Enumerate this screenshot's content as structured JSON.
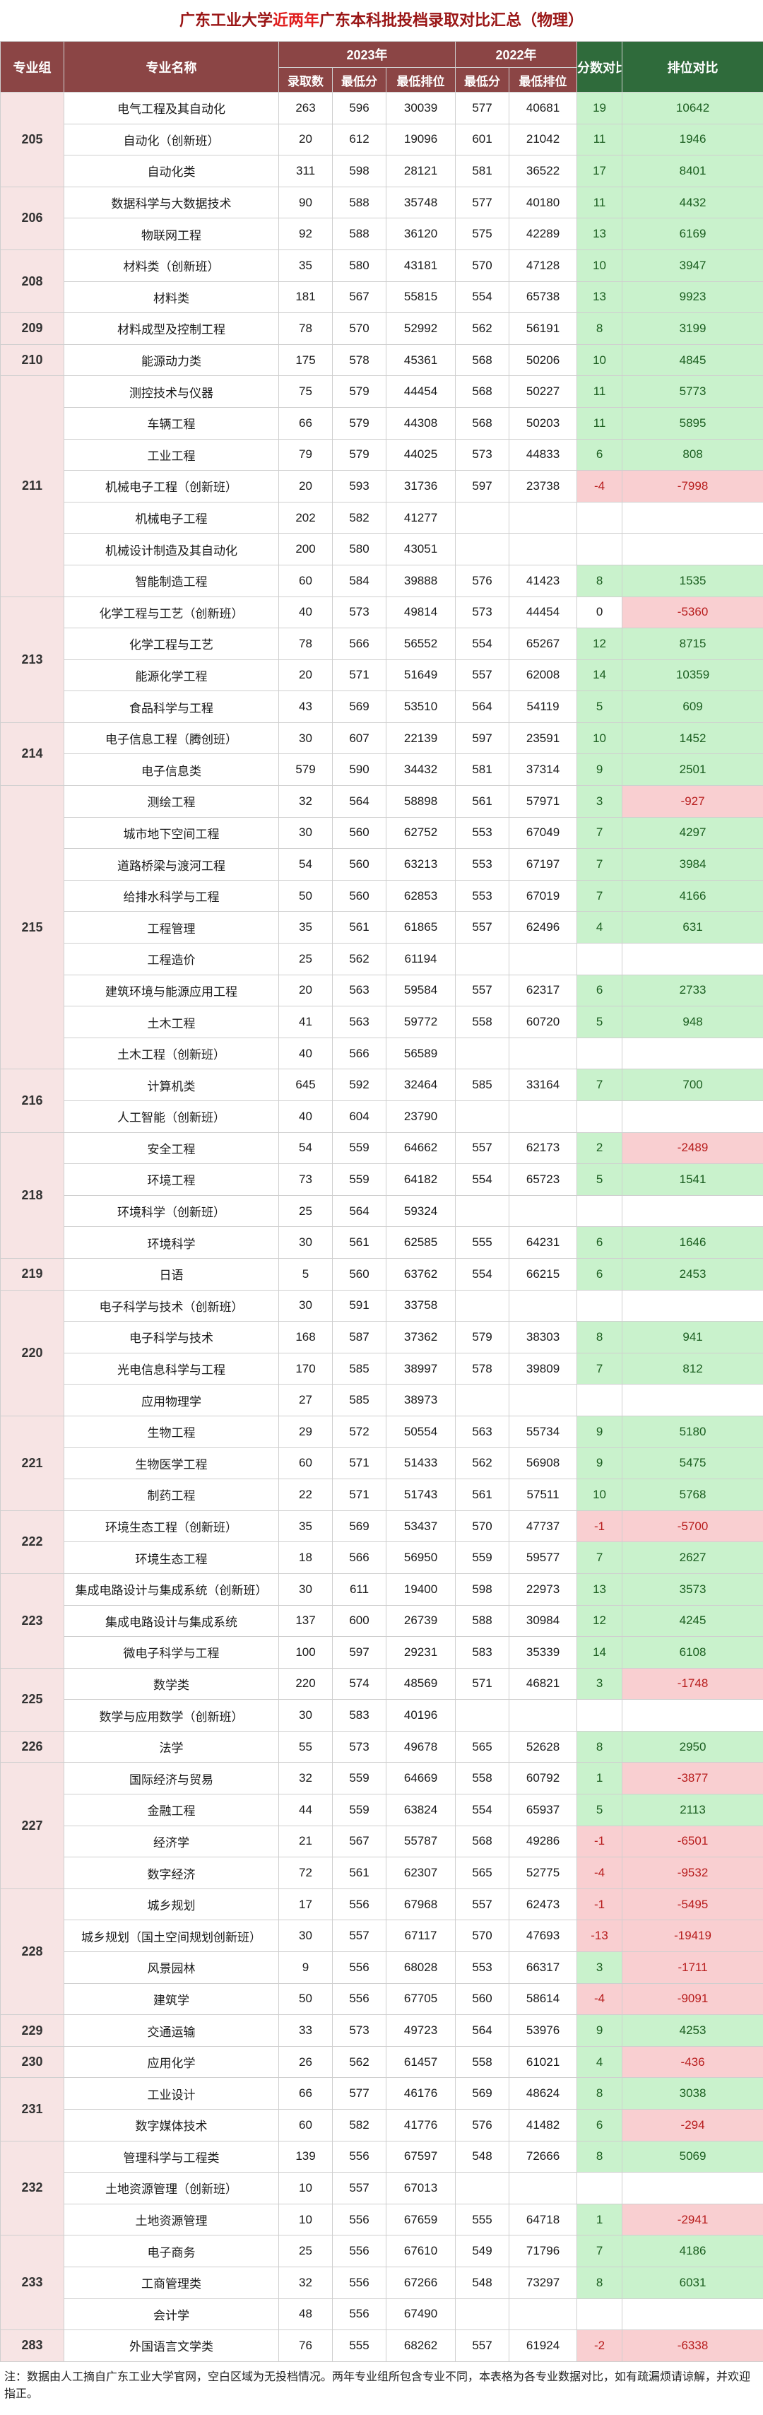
{
  "title": {
    "part1": "广东工业大学",
    "part2": "近两年",
    "part3": "广东本科批投档录取对比汇总（物理）"
  },
  "header": {
    "group": "专业组",
    "major": "专业名称",
    "y2023": "2023年",
    "y2022": "2022年",
    "enroll": "录取数",
    "minScore": "最低分",
    "minRank": "最低排位",
    "diffScore": "分数对比",
    "diffRank": "排位对比"
  },
  "groups": [
    {
      "group": "205",
      "rows": [
        [
          "电气工程及其自动化",
          "263",
          "596",
          "30039",
          "577",
          "40681",
          "19",
          "10642"
        ],
        [
          "自动化（创新班）",
          "20",
          "612",
          "19096",
          "601",
          "21042",
          "11",
          "1946"
        ],
        [
          "自动化类",
          "311",
          "598",
          "28121",
          "581",
          "36522",
          "17",
          "8401"
        ]
      ]
    },
    {
      "group": "206",
      "rows": [
        [
          "数据科学与大数据技术",
          "90",
          "588",
          "35748",
          "577",
          "40180",
          "11",
          "4432"
        ],
        [
          "物联网工程",
          "92",
          "588",
          "36120",
          "575",
          "42289",
          "13",
          "6169"
        ]
      ]
    },
    {
      "group": "208",
      "rows": [
        [
          "材料类（创新班）",
          "35",
          "580",
          "43181",
          "570",
          "47128",
          "10",
          "3947"
        ],
        [
          "材料类",
          "181",
          "567",
          "55815",
          "554",
          "65738",
          "13",
          "9923"
        ]
      ]
    },
    {
      "group": "209",
      "rows": [
        [
          "材料成型及控制工程",
          "78",
          "570",
          "52992",
          "562",
          "56191",
          "8",
          "3199"
        ]
      ]
    },
    {
      "group": "210",
      "rows": [
        [
          "能源动力类",
          "175",
          "578",
          "45361",
          "568",
          "50206",
          "10",
          "4845"
        ]
      ]
    },
    {
      "group": "211",
      "rows": [
        [
          "测控技术与仪器",
          "75",
          "579",
          "44454",
          "568",
          "50227",
          "11",
          "5773"
        ],
        [
          "车辆工程",
          "66",
          "579",
          "44308",
          "568",
          "50203",
          "11",
          "5895"
        ],
        [
          "工业工程",
          "79",
          "579",
          "44025",
          "573",
          "44833",
          "6",
          "808"
        ],
        [
          "机械电子工程（创新班）",
          "20",
          "593",
          "31736",
          "597",
          "23738",
          "-4",
          "-7998"
        ],
        [
          "机械电子工程",
          "202",
          "582",
          "41277",
          "",
          "",
          "",
          ""
        ],
        [
          "机械设计制造及其自动化",
          "200",
          "580",
          "43051",
          "",
          "",
          "",
          ""
        ],
        [
          "智能制造工程",
          "60",
          "584",
          "39888",
          "576",
          "41423",
          "8",
          "1535"
        ]
      ]
    },
    {
      "group": "213",
      "rows": [
        [
          "化学工程与工艺（创新班）",
          "40",
          "573",
          "49814",
          "573",
          "44454",
          "0",
          "-5360"
        ],
        [
          "化学工程与工艺",
          "78",
          "566",
          "56552",
          "554",
          "65267",
          "12",
          "8715"
        ],
        [
          "能源化学工程",
          "20",
          "571",
          "51649",
          "557",
          "62008",
          "14",
          "10359"
        ],
        [
          "食品科学与工程",
          "43",
          "569",
          "53510",
          "564",
          "54119",
          "5",
          "609"
        ]
      ]
    },
    {
      "group": "214",
      "rows": [
        [
          "电子信息工程（腾创班）",
          "30",
          "607",
          "22139",
          "597",
          "23591",
          "10",
          "1452"
        ],
        [
          "电子信息类",
          "579",
          "590",
          "34432",
          "581",
          "37314",
          "9",
          "2501"
        ]
      ]
    },
    {
      "group": "215",
      "rows": [
        [
          "测绘工程",
          "32",
          "564",
          "58898",
          "561",
          "57971",
          "3",
          "-927"
        ],
        [
          "城市地下空间工程",
          "30",
          "560",
          "62752",
          "553",
          "67049",
          "7",
          "4297"
        ],
        [
          "道路桥梁与渡河工程",
          "54",
          "560",
          "63213",
          "553",
          "67197",
          "7",
          "3984"
        ],
        [
          "给排水科学与工程",
          "50",
          "560",
          "62853",
          "553",
          "67019",
          "7",
          "4166"
        ],
        [
          "工程管理",
          "35",
          "561",
          "61865",
          "557",
          "62496",
          "4",
          "631"
        ],
        [
          "工程造价",
          "25",
          "562",
          "61194",
          "",
          "",
          "",
          ""
        ],
        [
          "建筑环境与能源应用工程",
          "20",
          "563",
          "59584",
          "557",
          "62317",
          "6",
          "2733"
        ],
        [
          "土木工程",
          "41",
          "563",
          "59772",
          "558",
          "60720",
          "5",
          "948"
        ],
        [
          "土木工程（创新班）",
          "40",
          "566",
          "56589",
          "",
          "",
          "",
          ""
        ]
      ]
    },
    {
      "group": "216",
      "rows": [
        [
          "计算机类",
          "645",
          "592",
          "32464",
          "585",
          "33164",
          "7",
          "700"
        ],
        [
          "人工智能（创新班）",
          "40",
          "604",
          "23790",
          "",
          "",
          "",
          ""
        ]
      ]
    },
    {
      "group": "218",
      "rows": [
        [
          "安全工程",
          "54",
          "559",
          "64662",
          "557",
          "62173",
          "2",
          "-2489"
        ],
        [
          "环境工程",
          "73",
          "559",
          "64182",
          "554",
          "65723",
          "5",
          "1541"
        ],
        [
          "环境科学（创新班）",
          "25",
          "564",
          "59324",
          "",
          "",
          "",
          ""
        ],
        [
          "环境科学",
          "30",
          "561",
          "62585",
          "555",
          "64231",
          "6",
          "1646"
        ]
      ]
    },
    {
      "group": "219",
      "rows": [
        [
          "日语",
          "5",
          "560",
          "63762",
          "554",
          "66215",
          "6",
          "2453"
        ]
      ]
    },
    {
      "group": "220",
      "rows": [
        [
          "电子科学与技术（创新班）",
          "30",
          "591",
          "33758",
          "",
          "",
          "",
          ""
        ],
        [
          "电子科学与技术",
          "168",
          "587",
          "37362",
          "579",
          "38303",
          "8",
          "941"
        ],
        [
          "光电信息科学与工程",
          "170",
          "585",
          "38997",
          "578",
          "39809",
          "7",
          "812"
        ],
        [
          "应用物理学",
          "27",
          "585",
          "38973",
          "",
          "",
          "",
          ""
        ]
      ]
    },
    {
      "group": "221",
      "rows": [
        [
          "生物工程",
          "29",
          "572",
          "50554",
          "563",
          "55734",
          "9",
          "5180"
        ],
        [
          "生物医学工程",
          "60",
          "571",
          "51433",
          "562",
          "56908",
          "9",
          "5475"
        ],
        [
          "制药工程",
          "22",
          "571",
          "51743",
          "561",
          "57511",
          "10",
          "5768"
        ]
      ]
    },
    {
      "group": "222",
      "rows": [
        [
          "环境生态工程（创新班）",
          "35",
          "569",
          "53437",
          "570",
          "47737",
          "-1",
          "-5700"
        ],
        [
          "环境生态工程",
          "18",
          "566",
          "56950",
          "559",
          "59577",
          "7",
          "2627"
        ]
      ]
    },
    {
      "group": "223",
      "rows": [
        [
          "集成电路设计与集成系统（创新班）",
          "30",
          "611",
          "19400",
          "598",
          "22973",
          "13",
          "3573"
        ],
        [
          "集成电路设计与集成系统",
          "137",
          "600",
          "26739",
          "588",
          "30984",
          "12",
          "4245"
        ],
        [
          "微电子科学与工程",
          "100",
          "597",
          "29231",
          "583",
          "35339",
          "14",
          "6108"
        ]
      ]
    },
    {
      "group": "225",
      "rows": [
        [
          "数学类",
          "220",
          "574",
          "48569",
          "571",
          "46821",
          "3",
          "-1748"
        ],
        [
          "数学与应用数学（创新班）",
          "30",
          "583",
          "40196",
          "",
          "",
          "",
          ""
        ]
      ]
    },
    {
      "group": "226",
      "rows": [
        [
          "法学",
          "55",
          "573",
          "49678",
          "565",
          "52628",
          "8",
          "2950"
        ]
      ]
    },
    {
      "group": "227",
      "rows": [
        [
          "国际经济与贸易",
          "32",
          "559",
          "64669",
          "558",
          "60792",
          "1",
          "-3877"
        ],
        [
          "金融工程",
          "44",
          "559",
          "63824",
          "554",
          "65937",
          "5",
          "2113"
        ],
        [
          "经济学",
          "21",
          "567",
          "55787",
          "568",
          "49286",
          "-1",
          "-6501"
        ],
        [
          "数字经济",
          "72",
          "561",
          "62307",
          "565",
          "52775",
          "-4",
          "-9532"
        ]
      ]
    },
    {
      "group": "228",
      "rows": [
        [
          "城乡规划",
          "17",
          "556",
          "67968",
          "557",
          "62473",
          "-1",
          "-5495"
        ],
        [
          "城乡规划（国土空间规划创新班）",
          "30",
          "557",
          "67117",
          "570",
          "47693",
          "-13",
          "-19419"
        ],
        [
          "风景园林",
          "9",
          "556",
          "68028",
          "553",
          "66317",
          "3",
          "-1711"
        ],
        [
          "建筑学",
          "50",
          "556",
          "67705",
          "560",
          "58614",
          "-4",
          "-9091"
        ]
      ]
    },
    {
      "group": "229",
      "rows": [
        [
          "交通运输",
          "33",
          "573",
          "49723",
          "564",
          "53976",
          "9",
          "4253"
        ]
      ]
    },
    {
      "group": "230",
      "rows": [
        [
          "应用化学",
          "26",
          "562",
          "61457",
          "558",
          "61021",
          "4",
          "-436"
        ]
      ]
    },
    {
      "group": "231",
      "rows": [
        [
          "工业设计",
          "66",
          "577",
          "46176",
          "569",
          "48624",
          "8",
          "3038"
        ],
        [
          "数字媒体技术",
          "60",
          "582",
          "41776",
          "576",
          "41482",
          "6",
          "-294"
        ]
      ]
    },
    {
      "group": "232",
      "rows": [
        [
          "管理科学与工程类",
          "139",
          "556",
          "67597",
          "548",
          "72666",
          "8",
          "5069"
        ],
        [
          "土地资源管理（创新班）",
          "10",
          "557",
          "67013",
          "",
          "",
          "",
          ""
        ],
        [
          "土地资源管理",
          "10",
          "556",
          "67659",
          "555",
          "64718",
          "1",
          "-2941"
        ]
      ]
    },
    {
      "group": "233",
      "rows": [
        [
          "电子商务",
          "25",
          "556",
          "67610",
          "549",
          "71796",
          "7",
          "4186"
        ],
        [
          "工商管理类",
          "32",
          "556",
          "67266",
          "548",
          "73297",
          "8",
          "6031"
        ],
        [
          "会计学",
          "48",
          "556",
          "67490",
          "",
          "",
          "",
          ""
        ]
      ]
    },
    {
      "group": "283",
      "rows": [
        [
          "外国语言文学类",
          "76",
          "555",
          "68262",
          "557",
          "61924",
          "-2",
          "-6338"
        ]
      ]
    }
  ],
  "footnote": "注：数据由人工摘自广东工业大学官网，空白区域为无投档情况。两年专业组所包含专业不同，本表格为各专业数据对比，如有疏漏烦请谅解，并欢迎指正。"
}
